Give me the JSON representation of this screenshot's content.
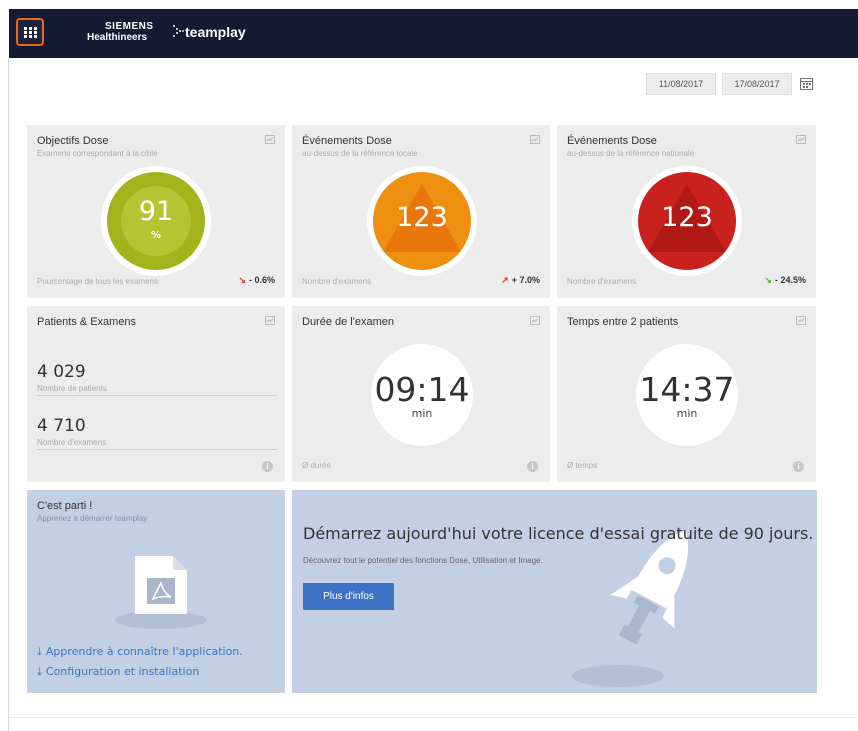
{
  "header": {
    "brand_line1": "SIEMENS",
    "brand_line2": "Healthineers",
    "app_name": "teamplay",
    "apps_icon": "apps-grid-icon",
    "accent_color": "#ec6b12",
    "bar_color": "#131a32"
  },
  "date_range": {
    "start": "11/08/2017",
    "end": "17/08/2017",
    "calendar_icon": "calendar-icon"
  },
  "cards": {
    "dose_goals": {
      "title": "Objectifs Dose",
      "subtitle": "Examens correspondant à la cible",
      "value": "91",
      "unit": "%",
      "footer": "Pourcentage de tous les examens",
      "trend": "- 0.6%",
      "trend_direction": "down",
      "color": "#a4b31c"
    },
    "dose_events_local": {
      "title": "Événements Dose",
      "subtitle": "au-dessus de la référence locale",
      "value": "123",
      "footer": "Nombre d'examens",
      "trend": "+ 7.0%",
      "trend_direction": "up",
      "color": "#ef8f10"
    },
    "dose_events_national": {
      "title": "Événements Dose",
      "subtitle": "au-dessus de la référence nationale",
      "value": "123",
      "footer": "Nombre d'examens",
      "trend": "- 24.5%",
      "trend_direction": "down",
      "color": "#c8211e"
    },
    "patients_exams": {
      "title": "Patients & Examens",
      "patients_value": "4 029",
      "patients_label": "Nombre de patients",
      "exams_value": "4 710",
      "exams_label": "Nombre d'examens"
    },
    "exam_duration": {
      "title": "Durée de l'examen",
      "value": "09:14",
      "unit": "min",
      "footer": "Ø durée"
    },
    "time_between": {
      "title": "Temps entre 2 patients",
      "value": "14:37",
      "unit": "min",
      "footer": "Ø temps"
    }
  },
  "getting_started": {
    "title": "C'est parti !",
    "subtitle": "Apprenez à démarrer teamplay",
    "link1": "Apprendre à connaître l'application.",
    "link2": "Configuration et installation"
  },
  "promo": {
    "heading": "Démarrez aujourd'hui votre licence d'essai gratuite de 90 jours.",
    "text": "Découvrez tout le potentiel des fonctions Dose, Utilisation et Image.",
    "button": "Plus d'infos"
  }
}
